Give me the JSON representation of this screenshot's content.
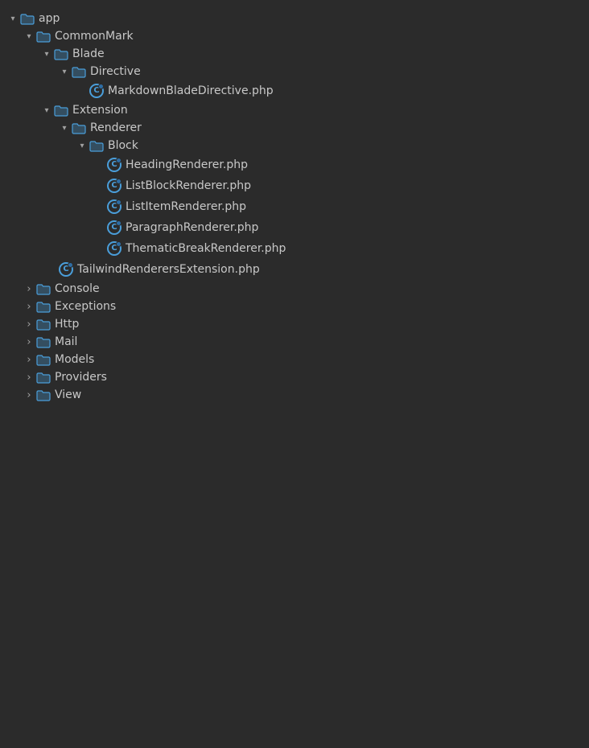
{
  "tree": {
    "app": {
      "label": "app",
      "expanded": true,
      "children": {
        "commonmark": {
          "label": "CommonMark",
          "expanded": true,
          "children": {
            "blade": {
              "label": "Blade",
              "expanded": true,
              "children": {
                "directive": {
                  "label": "Directive",
                  "expanded": true,
                  "children": {
                    "markdownBladeDirective": {
                      "label": "MarkdownBladeDirective.php",
                      "type": "file"
                    }
                  }
                }
              }
            },
            "extension": {
              "label": "Extension",
              "expanded": true,
              "children": {
                "renderer": {
                  "label": "Renderer",
                  "expanded": true,
                  "children": {
                    "block": {
                      "label": "Block",
                      "expanded": true,
                      "children": {
                        "headingRenderer": {
                          "label": "HeadingRenderer.php",
                          "type": "file"
                        },
                        "listBlockRenderer": {
                          "label": "ListBlockRenderer.php",
                          "type": "file"
                        },
                        "listItemRenderer": {
                          "label": "ListItemRenderer.php",
                          "type": "file"
                        },
                        "paragraphRenderer": {
                          "label": "ParagraphRenderer.php",
                          "type": "file"
                        },
                        "thematicBreakRenderer": {
                          "label": "ThematicBreakRenderer.php",
                          "type": "file"
                        }
                      }
                    }
                  }
                }
              }
            },
            "tailwindRenderersExtension": {
              "label": "TailwindRenderersExtension.php",
              "type": "file"
            }
          }
        },
        "console": {
          "label": "Console",
          "expanded": false
        },
        "exceptions": {
          "label": "Exceptions",
          "expanded": false
        },
        "http": {
          "label": "Http",
          "expanded": false
        },
        "mail": {
          "label": "Mail",
          "expanded": false
        },
        "models": {
          "label": "Models",
          "expanded": false
        },
        "providers": {
          "label": "Providers",
          "expanded": false
        },
        "view": {
          "label": "View",
          "expanded": false
        }
      }
    }
  }
}
